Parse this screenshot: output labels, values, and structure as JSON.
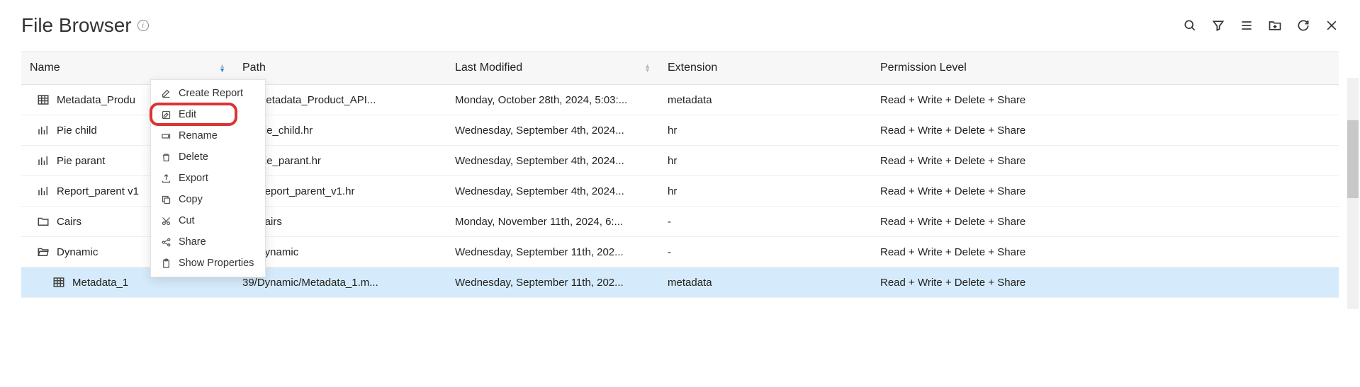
{
  "header": {
    "title": "File Browser"
  },
  "columns": {
    "name": "Name",
    "path": "Path",
    "modified": "Last Modified",
    "extension": "Extension",
    "permission": "Permission Level"
  },
  "rows": [
    {
      "icon": "grid",
      "name": "Metadata_Produ",
      "path": "39/Metadata_Product_API...",
      "modified": "Monday, October 28th, 2024, 5:03:...",
      "ext": "metadata",
      "perm": "Read + Write + Delete + Share",
      "indent": false
    },
    {
      "icon": "bar",
      "name": "Pie child",
      "path": "39/Pie_child.hr",
      "modified": "Wednesday, September 4th, 2024...",
      "ext": "hr",
      "perm": "Read + Write + Delete + Share",
      "indent": false
    },
    {
      "icon": "bar",
      "name": "Pie parant",
      "path": "39/Pie_parant.hr",
      "modified": "Wednesday, September 4th, 2024...",
      "ext": "hr",
      "perm": "Read + Write + Delete + Share",
      "indent": false
    },
    {
      "icon": "bar",
      "name": "Report_parent v1",
      "path": "39/Report_parent_v1.hr",
      "modified": "Wednesday, September 4th, 2024...",
      "ext": "hr",
      "perm": "Read + Write + Delete + Share",
      "indent": false
    },
    {
      "icon": "folder",
      "name": "Cairs",
      "path": "39/Cairs",
      "modified": "Monday, November 11th, 2024, 6:...",
      "ext": "-",
      "perm": "Read + Write + Delete + Share",
      "indent": false
    },
    {
      "icon": "folder-open",
      "name": "Dynamic",
      "path": "39/Dynamic",
      "modified": "Wednesday, September 11th, 202...",
      "ext": "-",
      "perm": "Read + Write + Delete + Share",
      "indent": false
    },
    {
      "icon": "grid",
      "name": "Metadata_1",
      "path": "39/Dynamic/Metadata_1.m...",
      "modified": "Wednesday, September 11th, 202...",
      "ext": "metadata",
      "perm": "Read + Write + Delete + Share",
      "indent": true,
      "selected": true
    }
  ],
  "menu": [
    {
      "icon": "pencil-line",
      "label": "Create Report"
    },
    {
      "icon": "edit-square",
      "label": "Edit"
    },
    {
      "icon": "rename",
      "label": "Rename"
    },
    {
      "icon": "trash",
      "label": "Delete"
    },
    {
      "icon": "export",
      "label": "Export"
    },
    {
      "icon": "copy",
      "label": "Copy"
    },
    {
      "icon": "cut",
      "label": "Cut"
    },
    {
      "icon": "share",
      "label": "Share"
    },
    {
      "icon": "clipboard",
      "label": "Show Properties"
    }
  ]
}
